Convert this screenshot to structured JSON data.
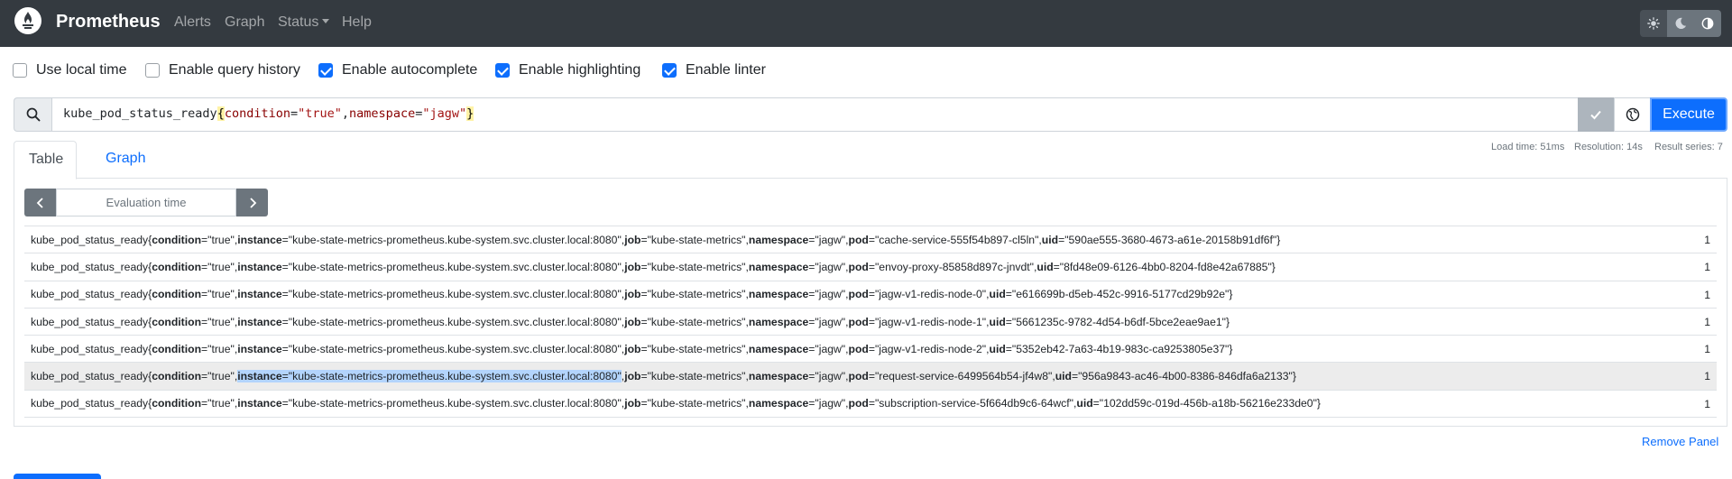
{
  "navbar": {
    "brand": "Prometheus",
    "links": [
      "Alerts",
      "Graph",
      "Status",
      "Help"
    ],
    "theme_buttons": [
      "sun-icon",
      "moon-icon",
      "half-circle-icon"
    ]
  },
  "options": [
    {
      "label": "Use local time",
      "checked": false
    },
    {
      "label": "Enable query history",
      "checked": false
    },
    {
      "label": "Enable autocomplete",
      "checked": true
    },
    {
      "label": "Enable highlighting",
      "checked": true
    },
    {
      "label": "Enable linter",
      "checked": true
    }
  ],
  "query": {
    "metric": "kube_pod_status_ready",
    "open": "{",
    "l1": "condition",
    "eq1": "=",
    "v1": "\"true\"",
    "comma": ",",
    "l2": "namespace",
    "eq2": "=",
    "v2": "\"jagw\"",
    "close": "}",
    "execute_label": "Execute"
  },
  "stats": {
    "load_time": "Load time: 51ms",
    "resolution": "Resolution: 14s",
    "result_series": "Result series: 7"
  },
  "tabs": {
    "table": "Table",
    "graph": "Graph"
  },
  "eval": {
    "placeholder": "Evaluation time"
  },
  "results": {
    "metric": "kube_pod_status_ready",
    "condition_value": "\"true\"",
    "instance_value": "\"kube-state-metrics-prometheus.kube-system.svc.cluster.local:8080\"",
    "job_value": "\"kube-state-metrics\"",
    "namespace_value": "\"jagw\"",
    "rows": [
      {
        "pod": "\"cache-service-555f54b897-cl5ln\"",
        "uid": "\"590ae555-3680-4673-a61e-20158b91df6f\"",
        "value": "1"
      },
      {
        "pod": "\"envoy-proxy-85858d897c-jnvdt\"",
        "uid": "\"8fd48e09-6126-4bb0-8204-fd8e42a67885\"",
        "value": "1"
      },
      {
        "pod": "\"jagw-v1-redis-node-0\"",
        "uid": "\"e616699b-d5eb-452c-9916-5177cd29b92e\"",
        "value": "1"
      },
      {
        "pod": "\"jagw-v1-redis-node-1\"",
        "uid": "\"5661235c-9782-4d54-b6df-5bce2eae9ae1\"",
        "value": "1"
      },
      {
        "pod": "\"jagw-v1-redis-node-2\"",
        "uid": "\"5352eb42-7a63-4b19-983c-ca9253805e37\"",
        "value": "1"
      },
      {
        "pod": "\"request-service-6499564b54-jf4w8\"",
        "uid": "\"956a9843-ac46-4b00-8386-846dfa6a2133\"",
        "value": "1"
      },
      {
        "pod": "\"subscription-service-5f664db9c6-64wcf\"",
        "uid": "\"102dd59c-019d-456b-a18b-56216e233de0\"",
        "value": "1"
      }
    ]
  },
  "remove_panel": "Remove Panel"
}
